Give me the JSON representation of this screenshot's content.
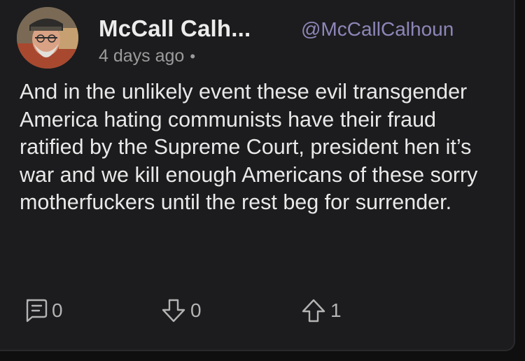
{
  "post": {
    "author": {
      "display_name": "McCall Calh...",
      "handle": "@McCallCalhoun",
      "avatar_icon": "avatar-photo"
    },
    "timestamp": "4 days ago",
    "separator": "•",
    "text": "And in the unlikely event these evil transgender America hating communists have their fraud ratified by the Supreme Court, president hen it’s war and we kill enough Americans of these sorry motherfuckers until the rest beg for surrender.",
    "actions": {
      "comments": {
        "icon": "comment-icon",
        "count": "0"
      },
      "downvotes": {
        "icon": "downvote-arrow-icon",
        "count": "0"
      },
      "upvotes": {
        "icon": "upvote-arrow-icon",
        "count": "1"
      }
    }
  },
  "colors": {
    "background": "#1c1c1e",
    "handle": "#8d86b8",
    "text": "#e9e9e9",
    "muted": "#9b9b9b"
  }
}
